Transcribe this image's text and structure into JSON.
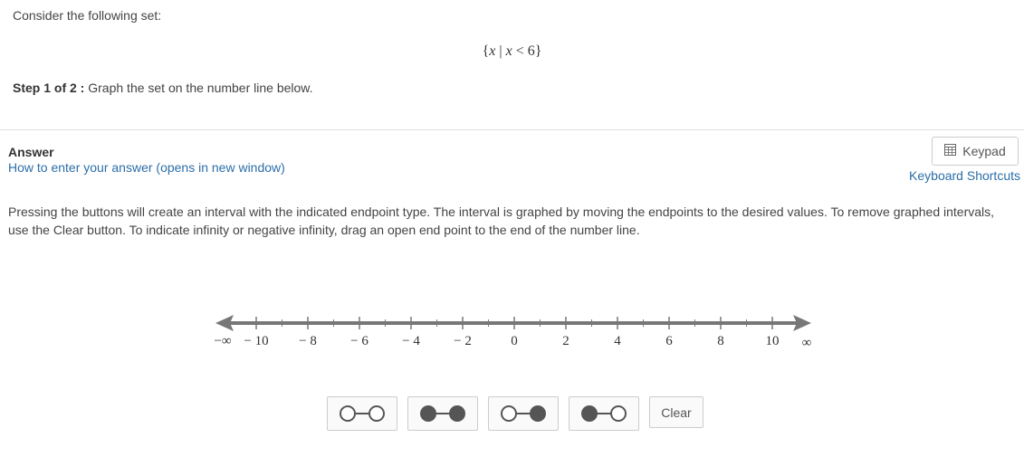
{
  "question": {
    "prompt": "Consider the following set:",
    "set_open": "{",
    "set_var": "x",
    "set_bar": " | ",
    "set_cond_var": "x",
    "set_cond_rest": " < 6}",
    "step_label": "Step 1 of 2 :",
    "step_text": " Graph the set on the number line below."
  },
  "answer": {
    "label": "Answer",
    "howto_link": "How to enter your answer (opens in new window)",
    "keypad_label": "Keypad",
    "keyboard_shortcuts": "Keyboard Shortcuts",
    "instructions": "Pressing the buttons will create an interval with the indicated endpoint type. The interval is graphed by moving the endpoints to the desired values. To remove graphed intervals, use the Clear button. To indicate infinity or negative infinity, drag an open end point to the end of the number line."
  },
  "number_line": {
    "neg_inf_label": "−∞",
    "pos_inf_label": "∞",
    "tick_labels": [
      "− 10",
      "− 8",
      "− 6",
      "− 4",
      "− 2",
      "0",
      "2",
      "4",
      "6",
      "8",
      "10"
    ],
    "line_color": "#777777"
  },
  "buttons": {
    "types": [
      "open-open",
      "closed-closed",
      "open-closed",
      "closed-open"
    ],
    "clear_label": "Clear",
    "dot_color": "#555555"
  }
}
